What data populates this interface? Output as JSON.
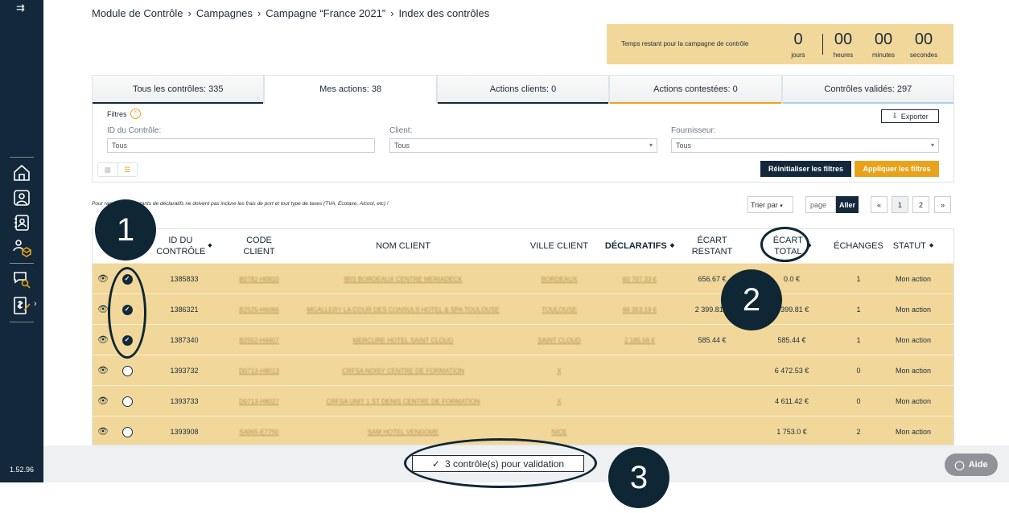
{
  "sidebar": {
    "version": "1.52.96",
    "icons": [
      "home-icon",
      "user-icon",
      "contacts-icon",
      "user-box-icon",
      "chat-search-icon",
      "invoice-icon"
    ]
  },
  "breadcrumb": [
    "Module de Contrôle",
    "Campagnes",
    "Campagne “France 2021”",
    "Index des contrôles"
  ],
  "timer": {
    "label": "Temps restant pour la campagne de contrôle",
    "days": "0",
    "days_unit": "jours",
    "hours": "00",
    "hours_unit": "heures",
    "minutes": "00",
    "minutes_unit": "minutes",
    "seconds": "00",
    "seconds_unit": "secondes"
  },
  "tabs": [
    {
      "label": "Tous les contrôles: 335",
      "color": "#13283a"
    },
    {
      "label": "Mes actions: 38",
      "color": ""
    },
    {
      "label": "Actions clients: 0",
      "color": "#13283a"
    },
    {
      "label": "Actions contestées: 0",
      "color": "#e8a31a"
    },
    {
      "label": "Contrôles validés: 297",
      "color": "#a9d3e8"
    }
  ],
  "filters": {
    "title": "Filtres",
    "id_label": "ID du Contrôle:",
    "id_placeholder": "Tous",
    "client_label": "Client:",
    "client_value": "Tous",
    "supplier_label": "Fournisseur:",
    "supplier_value": "Tous",
    "export": "Exporter",
    "reset": "Réinitialiser les filtres",
    "apply": "Appliquer les filtres"
  },
  "note": "Pour rappel, les montants de déclaratifs ne doivent pas inclure les frais de port et tout type de taxes (TVA, Ecotaxe, Alcool, etc) !",
  "pagination": {
    "sort": "Trier par",
    "page_placeholder": "page",
    "go": "Aller",
    "prev": "«",
    "pages": [
      "1",
      "2"
    ],
    "next": "»"
  },
  "table": {
    "headers": {
      "id": "ID DU CONTRÔLE",
      "code": "CODE CLIENT",
      "name": "NOM CLIENT",
      "city": "VILLE CLIENT",
      "decl": "DÉCLARATIFS",
      "ecart_restant": "ÉCART RESTANT",
      "ecart_total": "ÉCART TOTAL",
      "echanges": "ÉCHANGES",
      "statut": "STATUT"
    },
    "rows": [
      {
        "checked": true,
        "id": "1385833",
        "code": "B0782-H0910",
        "name": "IBIS BORDEAUX CENTRE MERIADECK",
        "city": "BORDEAUX",
        "decl": "60 707.33 €",
        "restant": "656.67 €",
        "total": "0.0 €",
        "echanges": "1",
        "statut": "Mon action"
      },
      {
        "checked": true,
        "id": "1386321",
        "code": "B2525-H6086",
        "name": "MGALLERY LA COUR DES CONSULS HOTEL & SPA TOULOUSE",
        "city": "TOULOUSE",
        "decl": "66 353.19 €",
        "restant": "2 399.81 €",
        "total": "2 399.81 €",
        "echanges": "1",
        "statut": "Mon action"
      },
      {
        "checked": true,
        "id": "1387340",
        "code": "B2552-H4607",
        "name": "MERCURE HOTEL SAINT CLOUD",
        "city": "SAINT CLOUD",
        "decl": "2 185.56 €",
        "restant": "585.44 €",
        "total": "585.44 €",
        "echanges": "1",
        "statut": "Mon action"
      },
      {
        "checked": false,
        "id": "1393732",
        "code": "D0713-H8013",
        "name": "CRFSA NOISY CENTRE DE FORMATION",
        "city": "X",
        "decl": "",
        "restant": "",
        "total": "6 472.53 €",
        "echanges": "0",
        "statut": "Mon action"
      },
      {
        "checked": false,
        "id": "1393733",
        "code": "D0713-H8027",
        "name": "CRFSA UNIT 1 ST DENIS CENTRE DE FORMATION",
        "city": "X",
        "decl": "",
        "restant": "",
        "total": "4 611.42 €",
        "echanges": "0",
        "statut": "Mon action"
      },
      {
        "checked": false,
        "id": "1393908",
        "code": "S4065-E7750",
        "name": "SAM HOTEL VENDOME",
        "city": "NICE",
        "decl": "",
        "restant": "",
        "total": "1 753.0 €",
        "echanges": "2",
        "statut": "Mon action"
      }
    ]
  },
  "validate_button": "3 contrôle(s) pour validation",
  "help_button": "Aide",
  "annotations": [
    "1",
    "2",
    "3"
  ],
  "colors": {
    "navy": "#13283a",
    "accent": "#e8a31a",
    "row": "#f1d89a"
  }
}
